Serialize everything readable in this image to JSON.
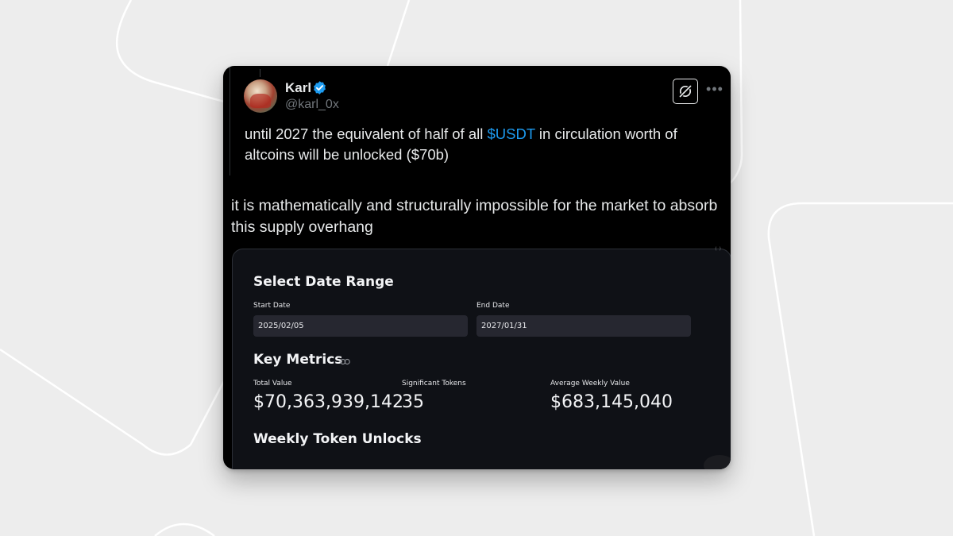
{
  "tweet": {
    "author_name": "Karl",
    "author_handle": "@karl_0x",
    "quote_text_before": "until 2027 the equivalent of half of all ",
    "quote_cashtag": "$USDT",
    "quote_text_after": " in circulation worth of altcoins will be unlocked ($70b)",
    "body_text": "it is mathematically and structurally impossible for the market to absorb this supply overhang",
    "icons": {
      "verified": "verified-badge-icon",
      "grok": "grok-icon",
      "more": "more-icon"
    },
    "colors": {
      "accent": "#1d9bf0",
      "card_bg": "#000000",
      "text": "#e7e9ea",
      "muted": "#71767b"
    }
  },
  "dashboard": {
    "date_range_title": "Select Date Range",
    "start_date_label": "Start Date",
    "start_date_value": "2025/02/05",
    "end_date_label": "End Date",
    "end_date_value": "2027/01/31",
    "key_metrics_title": "Key Metrics",
    "metrics": [
      {
        "label": "Total Value",
        "value": "$70,363,939,142"
      },
      {
        "label": "Significant Tokens",
        "value": "35"
      },
      {
        "label": "Average Weekly Value",
        "value": "$683,145,040"
      }
    ],
    "weekly_unlocks_title": "Weekly Token Unlocks",
    "colors": {
      "panel_bg": "#0f1116",
      "input_bg": "#262730"
    }
  }
}
